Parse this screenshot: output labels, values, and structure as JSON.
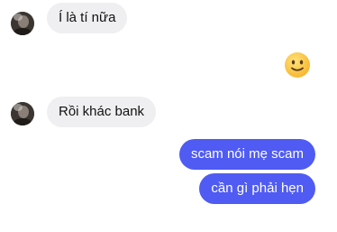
{
  "messages": [
    {
      "side": "incoming",
      "text": "Í là tí nữa"
    },
    {
      "side": "outgoing",
      "emoji": "slightly-smiling-face"
    },
    {
      "side": "incoming",
      "text": "Rồi khác bank"
    },
    {
      "side": "outgoing",
      "text": "scam nói mẹ scam"
    },
    {
      "side": "outgoing",
      "text": "cần gì phải hẹn"
    }
  ],
  "colors": {
    "incoming_bubble": "#efeff1",
    "outgoing_bubble": "#4f5bf2",
    "emoji_face": "#fcc63c"
  }
}
